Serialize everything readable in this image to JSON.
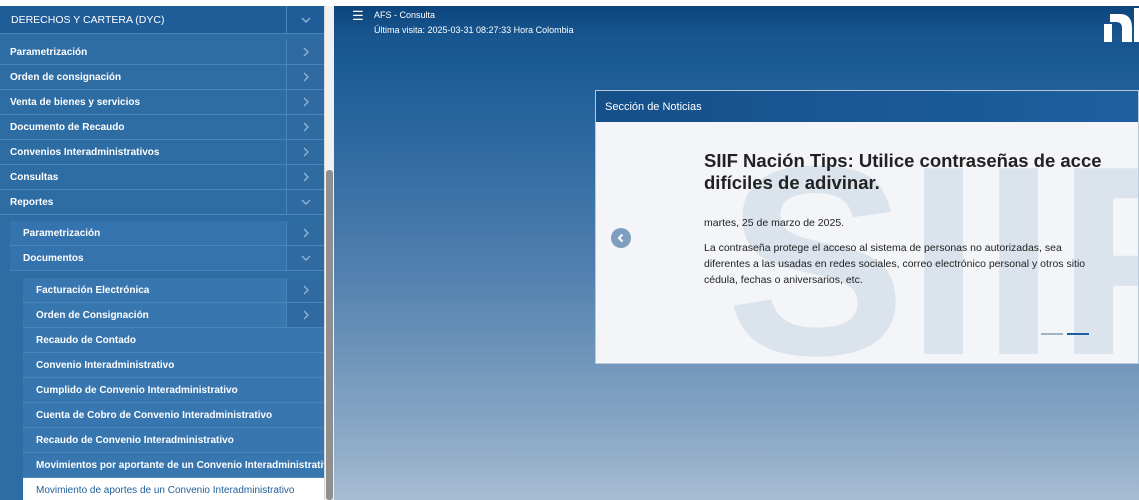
{
  "sidebar": {
    "header": "DERECHOS Y CARTERA (DYC)",
    "items": [
      {
        "label": "Parametrización"
      },
      {
        "label": "Orden de consignación"
      },
      {
        "label": "Venta de bienes y servicios"
      },
      {
        "label": "Documento de Recaudo"
      },
      {
        "label": "Convenios Interadministrativos"
      },
      {
        "label": "Consultas"
      },
      {
        "label": "Reportes"
      }
    ],
    "reportes_children": [
      {
        "label": "Parametrización"
      },
      {
        "label": "Documentos"
      }
    ],
    "documentos_children": [
      {
        "label": "Facturación Electrónica"
      },
      {
        "label": "Orden de Consignación"
      },
      {
        "label": "Recaudo de Contado"
      },
      {
        "label": "Convenio Interadministrativo"
      },
      {
        "label": "Cumplido de Convenio Interadministrativo"
      },
      {
        "label": "Cuenta de Cobro de Convenio Interadministrativo"
      },
      {
        "label": "Recaudo de Convenio Interadministrativo"
      },
      {
        "label": "Movimientos por aportante de un Convenio Interadministrativo"
      },
      {
        "label": "Movimiento de aportes de un Convenio Interadministrativo"
      }
    ]
  },
  "header": {
    "menu_icon": "hamburger-icon",
    "app_name": "AFS - Consulta",
    "last_visit": "Última visita: 2025-03-31 08:27:33 Hora Colombia"
  },
  "news": {
    "section_title": "Sección de Noticias",
    "title_line1": "SIIF Nación Tips: Utilice contraseñas de acce",
    "title_line2": "difíciles de adivinar.",
    "date": "martes, 25 de marzo de 2025.",
    "body_line1": "La contraseña protege el acceso al sistema de personas no autorizadas, sea",
    "body_line2": "diferentes a las usadas en redes sociales, correo electrónico personal y otros sitio",
    "body_line3": "cédula, fechas o aniversarios, etc.",
    "watermark_text": "SIIF"
  },
  "colors": {
    "sidebar": "#2e6da4",
    "header": "#0d457d",
    "accent": "#1d5f9f"
  }
}
